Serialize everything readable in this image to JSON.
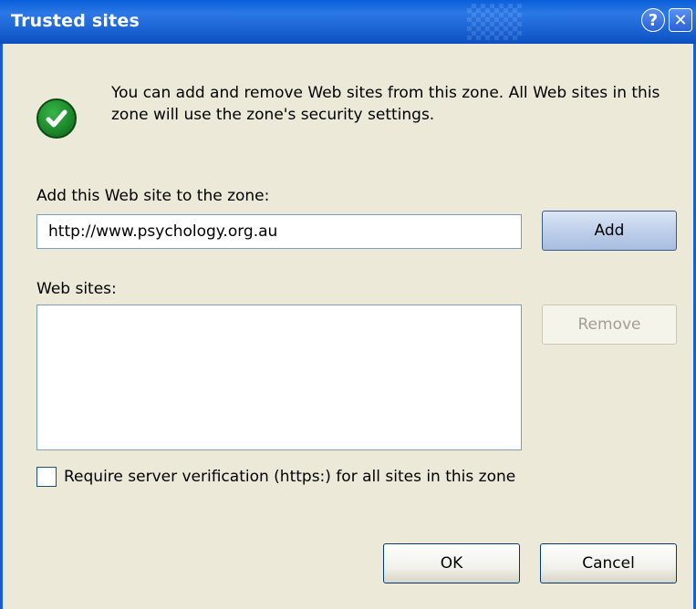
{
  "window": {
    "title": "Trusted sites",
    "help_glyph": "?",
    "close_glyph": "✕"
  },
  "info": {
    "icon": "check-icon",
    "message": "You can add and remove Web sites from this zone. All Web sites in this zone will use the zone's security settings."
  },
  "add_section": {
    "label": "Add this Web site to the zone:",
    "url_value": "http://www.psychology.org.au",
    "add_button": "Add"
  },
  "sites_section": {
    "label": "Web sites:",
    "items": [],
    "remove_button": "Remove"
  },
  "https_checkbox": {
    "label": "Require server verification (https:) for all sites in this zone",
    "checked": false
  },
  "footer": {
    "ok_button": "OK",
    "cancel_button": "Cancel"
  },
  "colors": {
    "title_bar": "#0a5ed8",
    "dialog_bg": "#ece9d8",
    "icon_green": "#1e8a2c"
  }
}
